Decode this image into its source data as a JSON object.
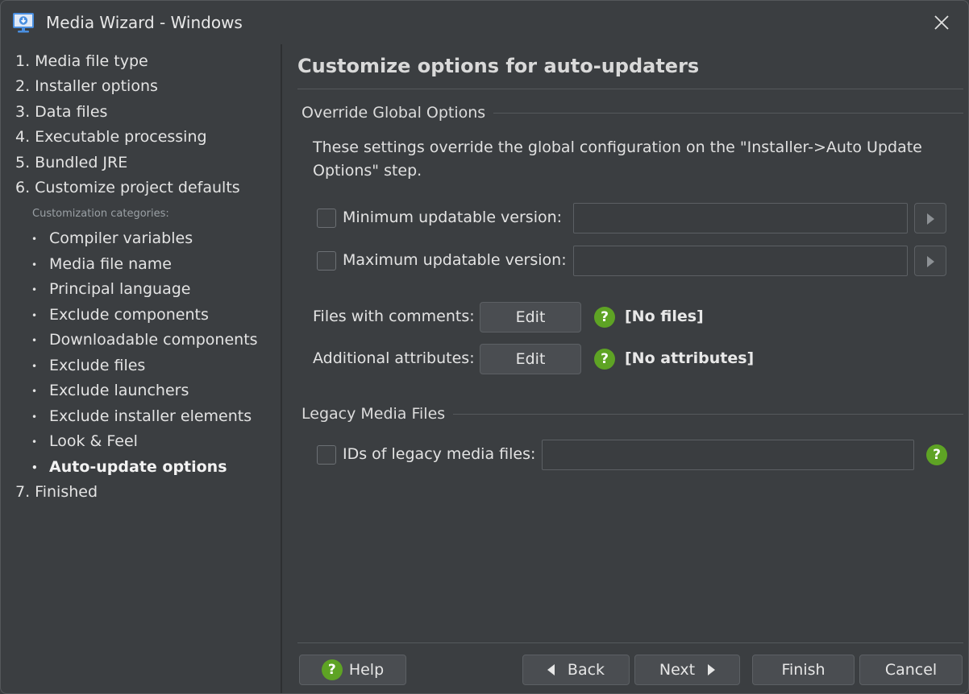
{
  "window": {
    "title": "Media Wizard - Windows"
  },
  "sidebar": {
    "steps": [
      {
        "label": "1. Media file type"
      },
      {
        "label": "2. Installer options"
      },
      {
        "label": "3. Data files"
      },
      {
        "label": "4. Executable processing"
      },
      {
        "label": "5. Bundled JRE"
      },
      {
        "label": "6. Customize project defaults"
      }
    ],
    "categories_label": "Customization categories:",
    "bullet": "•",
    "sub_items": [
      {
        "label": "Compiler variables"
      },
      {
        "label": "Media file name"
      },
      {
        "label": "Principal language"
      },
      {
        "label": "Exclude components"
      },
      {
        "label": "Downloadable components"
      },
      {
        "label": "Exclude files"
      },
      {
        "label": "Exclude launchers"
      },
      {
        "label": "Exclude installer elements"
      },
      {
        "label": "Look & Feel"
      },
      {
        "label": "Auto-update options",
        "active": true
      }
    ],
    "final_step": "7. Finished"
  },
  "main": {
    "heading": "Customize options for auto-updaters",
    "override_section": "Override Global Options",
    "description": "These settings override the global configuration on the \"Installer->Auto Update Options\" step.",
    "min_version_label": "Minimum updatable version:",
    "min_version_value": "",
    "max_version_label": "Maximum updatable version:",
    "max_version_value": "",
    "files_comments_label": "Files with comments:",
    "files_comments_value": "[No files]",
    "additional_attrs_label": "Additional attributes:",
    "additional_attrs_value": "[No attributes]",
    "edit_label": "Edit",
    "help_glyph": "?",
    "legacy_section": "Legacy Media Files",
    "legacy_ids_label": "IDs of legacy media files:",
    "legacy_ids_value": ""
  },
  "footer": {
    "help": "Help",
    "back": "Back",
    "next": "Next",
    "finish": "Finish",
    "cancel": "Cancel"
  },
  "colors": {
    "accent_help": "#5ea324",
    "icon_blue": "#4a8fe0"
  }
}
